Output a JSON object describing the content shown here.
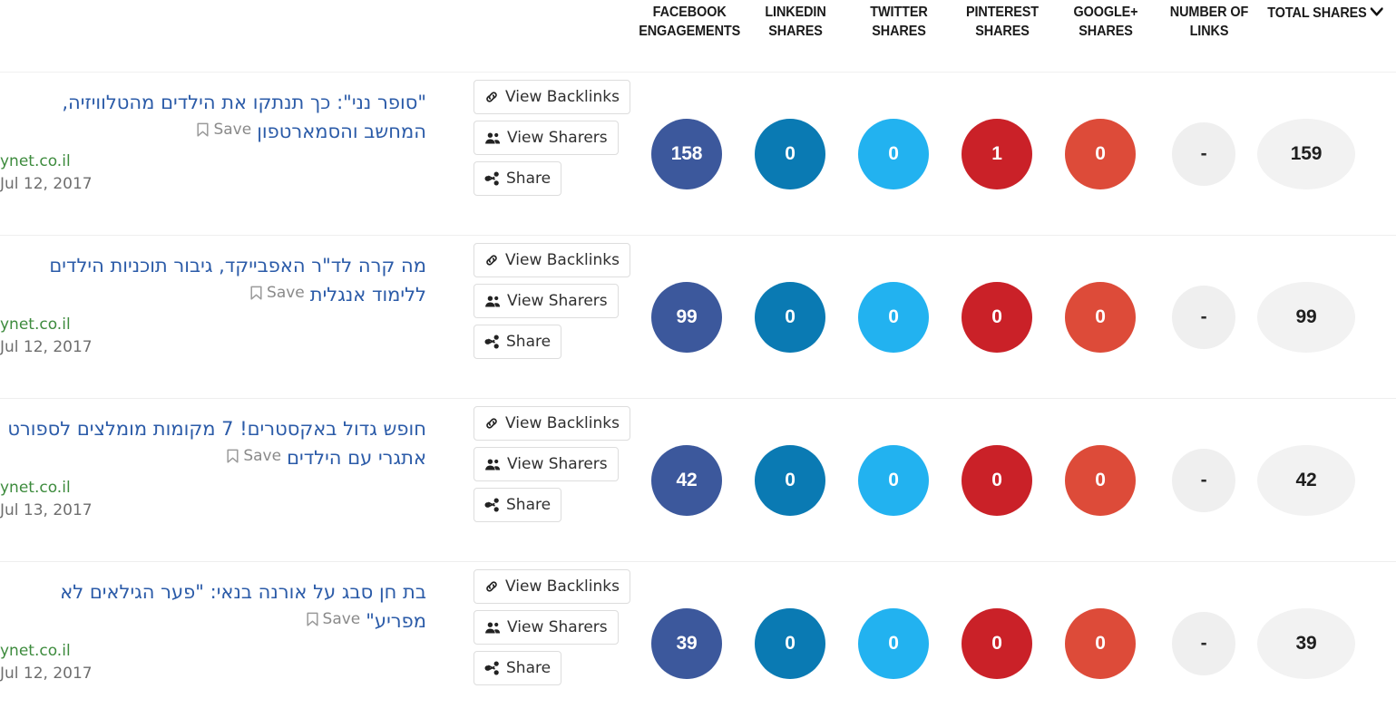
{
  "header": {
    "columns": [
      {
        "id": "facebook",
        "label": "FACEBOOK ENGAGEMENTS"
      },
      {
        "id": "linkedin",
        "label": "LINKEDIN SHARES"
      },
      {
        "id": "twitter",
        "label": "TWITTER SHARES"
      },
      {
        "id": "pinterest",
        "label": "PINTEREST SHARES"
      },
      {
        "id": "googleplus",
        "label": "GOOGLE+ SHARES"
      },
      {
        "id": "links",
        "label": "NUMBER OF LINKS"
      },
      {
        "id": "total",
        "label": "TOTAL SHARES",
        "sorted": true,
        "sort_icon": "chevron-down-icon",
        "caret": "⌄"
      }
    ]
  },
  "actions": {
    "backlinks_label": "View Backlinks",
    "backlinks_icon": "link-chain-icon",
    "sharers_label": "View Sharers",
    "sharers_icon": "users-group-icon",
    "share_label": "Share",
    "share_icon": "share-nodes-icon",
    "save_label": "Save",
    "save_icon": "bookmark-icon"
  },
  "colors": {
    "facebook": "#3c589c",
    "linkedin": "#0a7ab3",
    "twitter": "#22b2f0",
    "pinterest": "#ca2128",
    "googleplus": "#dd4b39",
    "neutral": "#efefef",
    "total": "#f2f2f2",
    "title_link": "#2b5ba8",
    "source_link": "#3d8b3d",
    "date_text": "#6e6e6e"
  },
  "rows": [
    {
      "title": "\"סופר נני\": כך תנתקו את הילדים מהטלוויזיה, המחשב והסמארטפון",
      "source": "ynet.co.il",
      "date": "Jul 12, 2017",
      "facebook": "158",
      "linkedin": "0",
      "twitter": "0",
      "pinterest": "1",
      "googleplus": "0",
      "links": "-",
      "total": "159"
    },
    {
      "title": "מה קרה לד\"ר האפבייקד, גיבור תוכניות הילדים ללימוד אנגלית",
      "source": "ynet.co.il",
      "date": "Jul 12, 2017",
      "facebook": "99",
      "linkedin": "0",
      "twitter": "0",
      "pinterest": "0",
      "googleplus": "0",
      "links": "-",
      "total": "99"
    },
    {
      "title": "חופש גדול באקסטרים! 7 מקומות מומלצים לספורט אתגרי עם הילדים",
      "source": "ynet.co.il",
      "date": "Jul 13, 2017",
      "facebook": "42",
      "linkedin": "0",
      "twitter": "0",
      "pinterest": "0",
      "googleplus": "0",
      "links": "-",
      "total": "42"
    },
    {
      "title": "בת חן סבג על אורנה בנאי: \"פער הגילאים לא מפריע\"",
      "source": "ynet.co.il",
      "date": "Jul 12, 2017",
      "facebook": "39",
      "linkedin": "0",
      "twitter": "0",
      "pinterest": "0",
      "googleplus": "0",
      "links": "-",
      "total": "39"
    }
  ]
}
